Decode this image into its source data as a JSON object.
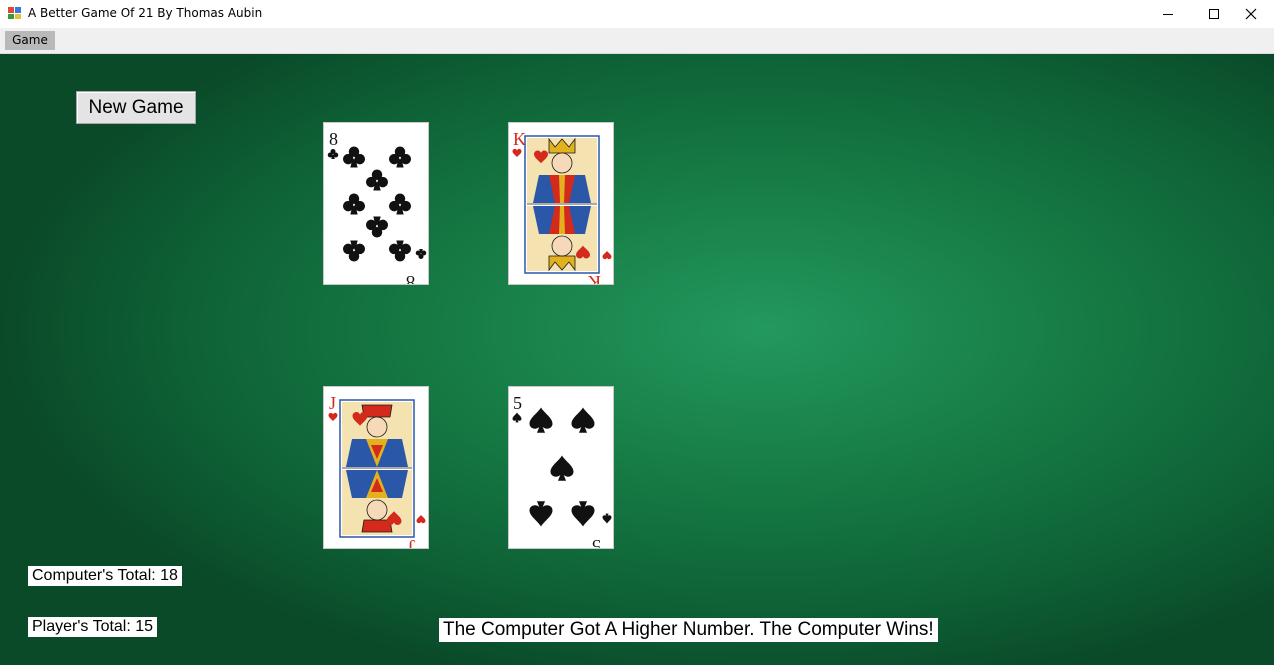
{
  "window": {
    "title": "A Better Game Of 21 By Thomas Aubin",
    "controls": {
      "minimize": "minimize-icon",
      "maximize": "maximize-icon",
      "close": "close-icon"
    }
  },
  "menu": {
    "items": [
      {
        "label": "Game"
      }
    ]
  },
  "buttons": {
    "new_game": "New Game"
  },
  "cards": {
    "computer": [
      {
        "rank": "8",
        "suit": "clubs",
        "color": "#111111"
      },
      {
        "rank": "K",
        "suit": "hearts",
        "color": "#d42a1c"
      }
    ],
    "player": [
      {
        "rank": "J",
        "suit": "hearts",
        "color": "#d42a1c"
      },
      {
        "rank": "5",
        "suit": "spades",
        "color": "#111111"
      }
    ]
  },
  "totals": {
    "computer": "Computer's Total: 18",
    "player": "Player's Total: 15"
  },
  "status_message": "The Computer Got A Higher Number. The Computer Wins!",
  "colors": {
    "felt": "#188048",
    "felt_dark": "#0a4a29",
    "red_suit": "#d42a1c",
    "black_suit": "#111111"
  }
}
